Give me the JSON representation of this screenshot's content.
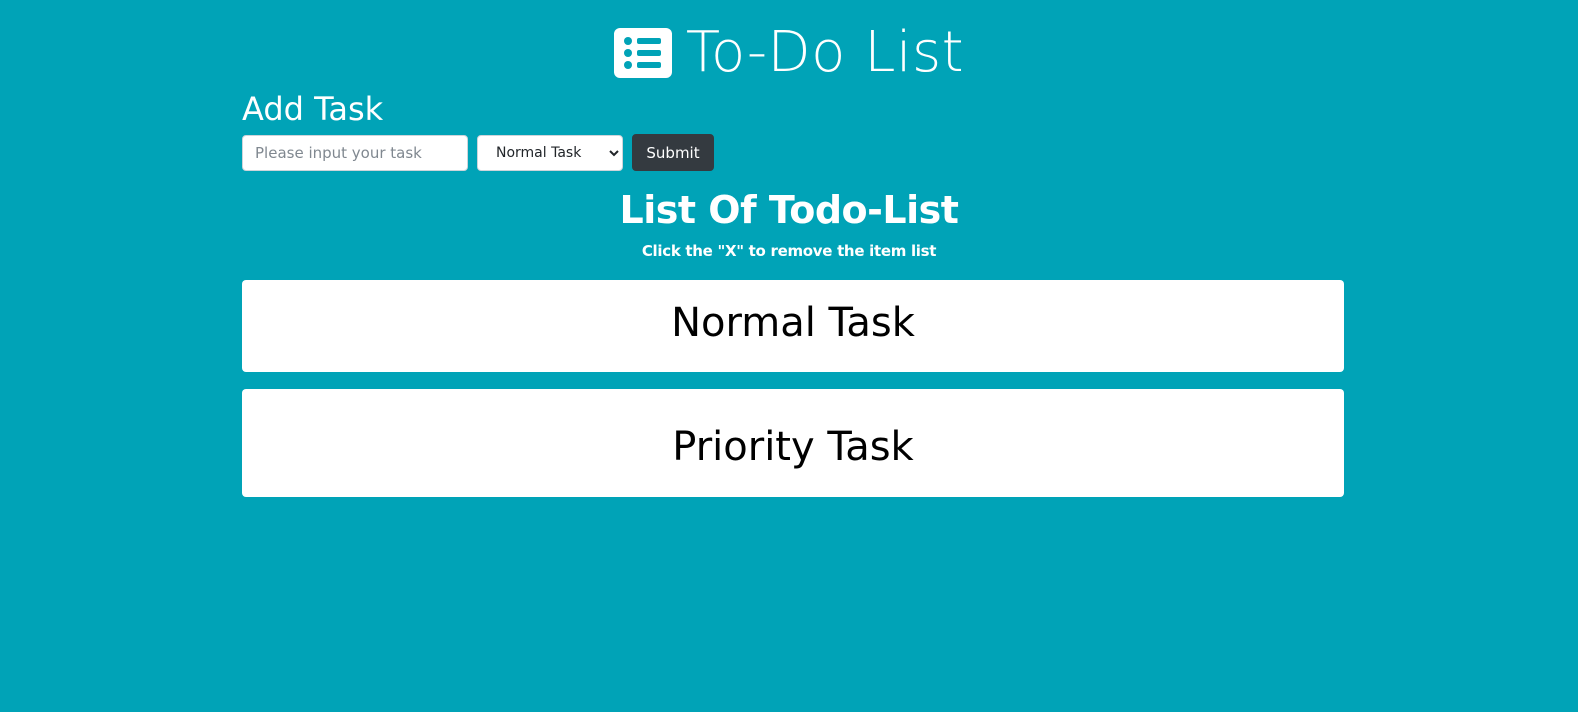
{
  "colors": {
    "background": "#00a3b7",
    "submit_button": "#343a40",
    "card": "#ffffff"
  },
  "header": {
    "icon": "list-icon",
    "title": "To-Do List"
  },
  "add_task": {
    "label": "Add Task",
    "input_placeholder": "Please input your task",
    "input_value": "",
    "select_value": "Normal Task",
    "submit_label": "Submit"
  },
  "list": {
    "title": "List Of Todo-List",
    "hint": "Click the \"X\" to remove the item list",
    "items": [
      {
        "label": "Normal Task"
      },
      {
        "label": "Priority Task"
      }
    ]
  }
}
